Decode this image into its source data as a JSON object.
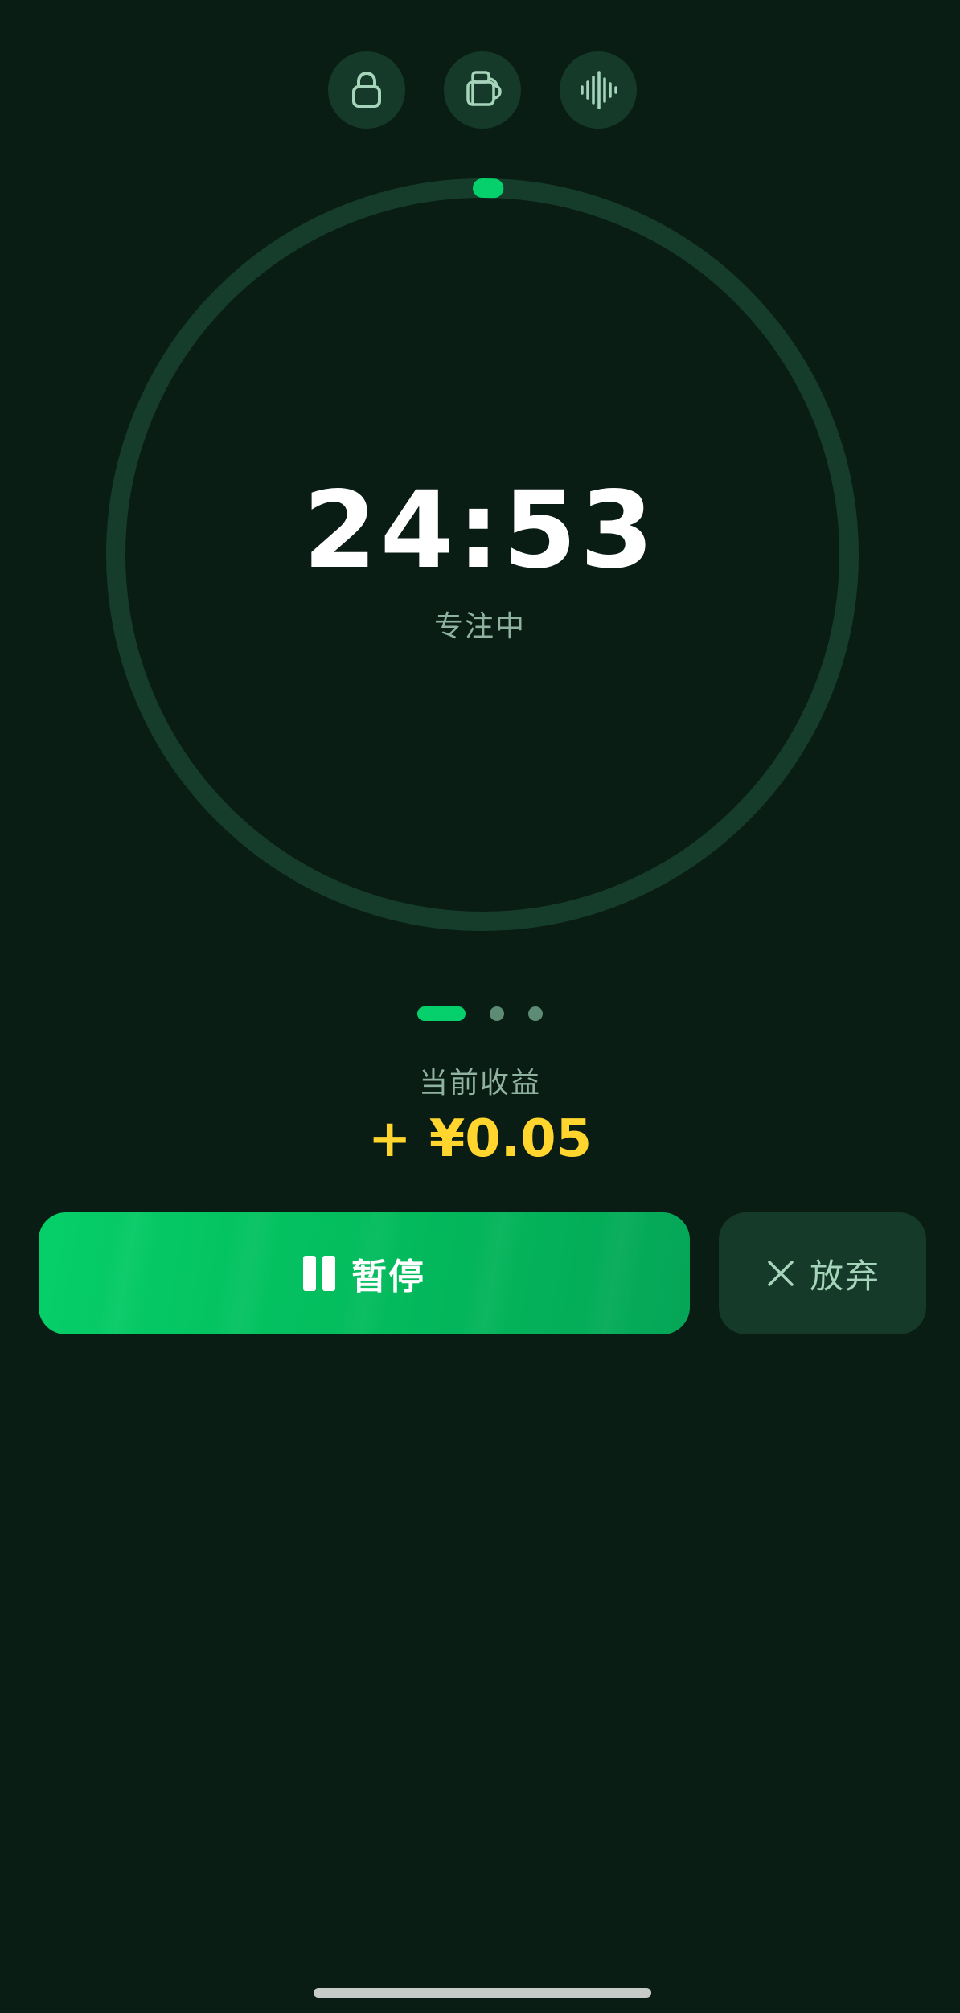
{
  "toolbar": {
    "icons": [
      "lock-icon",
      "cup-icon",
      "sound-wave-icon"
    ]
  },
  "timer": {
    "time": "24:53",
    "status": "专注中",
    "progress": 0.005
  },
  "pager": {
    "count": 3,
    "active_index": 0
  },
  "earnings": {
    "label": "当前收益",
    "value": "+ ¥0.05"
  },
  "actions": {
    "pause_label": "暂停",
    "quit_label": "放弃"
  },
  "colors": {
    "background": "#0a1d14",
    "accent_green": "#06d06b",
    "ring_track": "#163d2b",
    "earnings_yellow": "#ffd52e",
    "muted_text": "#8fb3a0"
  }
}
